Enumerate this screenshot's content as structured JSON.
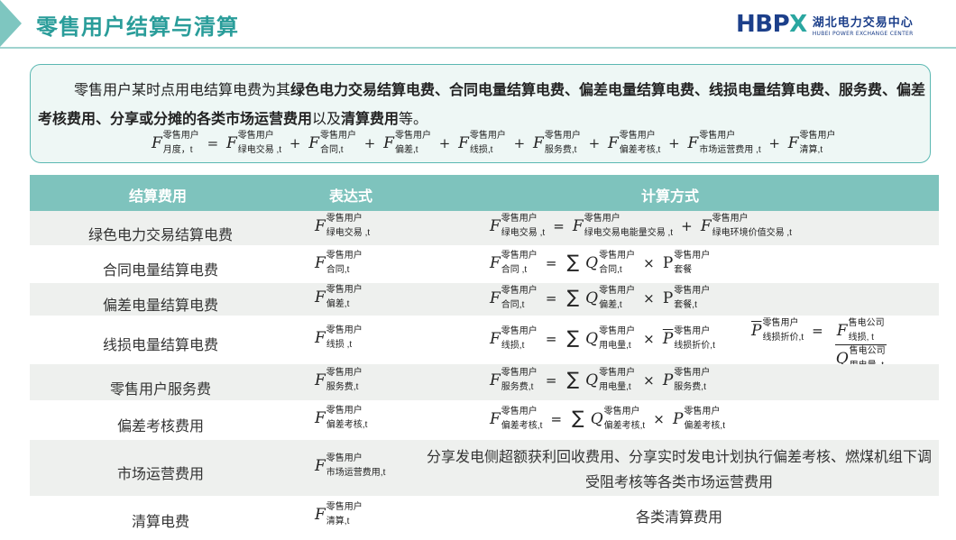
{
  "header": {
    "title": "零售用户结算与清算",
    "logo_mark_left": "HBP",
    "logo_mark_right": "X",
    "logo_cn": "湖北电力交易中心",
    "logo_en": "HUBEI POWER EXCHANGE CENTER"
  },
  "intro": {
    "t1": "零售用户某时点用电结算电费为其",
    "b1": "绿色电力交易结算电费、合同电量结算电费、偏差电量结算电费、线损电量结算电费、服务费、偏差考核费用、分享或分摊的各类市场运营费用",
    "t2": "以及",
    "b2": "清算费用",
    "t3": "等。",
    "formula": {
      "F": "F",
      "sup": "零售用户",
      "lhs_sub": "月度，t",
      "terms": [
        "绿电交易 ,t",
        "合同,t",
        "偏差,t",
        "线损,t",
        "服务费,t",
        "偏差考核,t",
        "市场运营费用 ,t",
        "清算,t"
      ],
      "plus": "+",
      "eq": "="
    }
  },
  "table": {
    "headers": [
      "结算费用",
      "表达式",
      "计算方式"
    ],
    "rows": [
      {
        "name": "绿色电力交易结算电费",
        "expr_sub": "绿电交易 ,t"
      },
      {
        "name": "合同电量结算电费",
        "expr_sub": "合同,t"
      },
      {
        "name": "偏差电量结算电费",
        "expr_sub": "偏差,t"
      },
      {
        "name": "线损电量结算电费",
        "expr_sub": "线损 ,t"
      },
      {
        "name": "零售用户服务费",
        "expr_sub": "服务费,t"
      },
      {
        "name": "偏差考核费用",
        "expr_sub": "偏差考核,t"
      },
      {
        "name": "市场运营费用",
        "expr_sub": "市场运营费用,t",
        "calc_text": "分享发电侧超额获利回收费用、分享实时发电计划执行偏差考核、燃煤机组下调受阻考核等各类市场运营费用"
      },
      {
        "name": "清算电费",
        "expr_sub": "清算,t",
        "calc_text": "各类清算费用"
      }
    ],
    "calc": {
      "F": "F",
      "Q": "Q",
      "P": "P",
      "sum": "∑",
      "times": "×",
      "plus": "+",
      "eq": "=",
      "u": "零售用户",
      "r1": {
        "a": "绿电交易 ,t",
        "b": "绿电交易电能量交易 ,t",
        "c": "绿电环境价值交易 ,t"
      },
      "r2": {
        "a": "合同 ,t",
        "b": "合同,t",
        "c": "套餐"
      },
      "r3": {
        "a": "合同,t",
        "b": "偏差,t",
        "c": "套餐,t"
      },
      "r4": {
        "a": "线损,t",
        "b": "用电量,t",
        "c": "线损折价,t",
        "d": "线损折价,t",
        "e": "售电公司",
        "f": "线损, t",
        "g": "用电量, t"
      },
      "r5": {
        "a": "服务费,t",
        "b": "用电量,t",
        "c": "服务费,t"
      },
      "r6": {
        "a": "偏差考核,t",
        "b": "偏差考核,t",
        "c": "偏差考核,t"
      }
    }
  }
}
